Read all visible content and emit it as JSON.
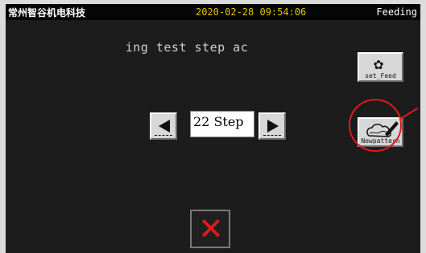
{
  "header": {
    "brand": "常州智谷机电科技",
    "datetime": "2020-02-28 09:54:06",
    "mode": "Feeding"
  },
  "message": "ing test step ac",
  "stepper": {
    "value": "22 Step"
  },
  "buttons": {
    "set_feed_label": "set_Feed",
    "new_pattern_label": "Newpattern"
  },
  "icons": {
    "left": "arrow-left-icon",
    "right": "arrow-right-icon",
    "set_feed": "flower-icon",
    "new_pattern": "pattern-pencil-icon",
    "close": "close-icon"
  },
  "colors": {
    "screen_bg": "#1c1c1c",
    "datetime": "#e6c200",
    "highlight": "#e0181c",
    "close_x": "#e21b1b"
  }
}
